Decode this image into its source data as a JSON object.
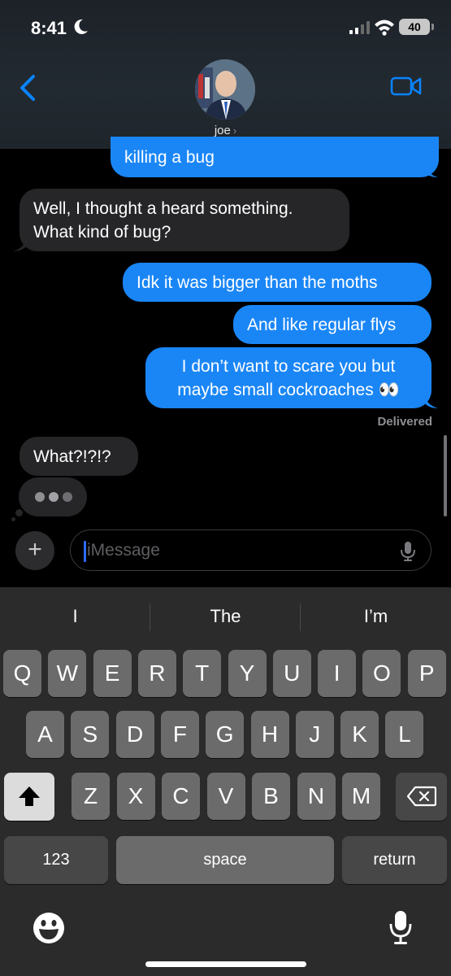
{
  "status_bar": {
    "time": "8:41",
    "battery": "40"
  },
  "header": {
    "contact_name": "joe",
    "chevron": "›"
  },
  "messages": [
    {
      "type": "sent",
      "text": "killing a bug"
    },
    {
      "type": "received",
      "text": "Well, I thought a heard something. What kind of bug?"
    },
    {
      "type": "sent",
      "text": "Idk it was bigger than the moths"
    },
    {
      "type": "sent",
      "text": "And like regular flys"
    },
    {
      "type": "sent",
      "text": "I don’t want to scare you but maybe small cockroaches 👀"
    },
    {
      "type": "received",
      "text": "What?!?!?"
    }
  ],
  "delivered_label": "Delivered",
  "input": {
    "placeholder": "iMessage",
    "plus": "+"
  },
  "keyboard": {
    "suggestions": [
      "I",
      "The",
      "I’m"
    ],
    "row1": [
      "Q",
      "W",
      "E",
      "R",
      "T",
      "Y",
      "U",
      "I",
      "O",
      "P"
    ],
    "row2": [
      "A",
      "S",
      "D",
      "F",
      "G",
      "H",
      "J",
      "K",
      "L"
    ],
    "row3": [
      "Z",
      "X",
      "C",
      "V",
      "B",
      "N",
      "M"
    ],
    "numbers_label": "123",
    "space_label": "space",
    "return_label": "return"
  },
  "colors": {
    "sent_bubble": "#1a86f6",
    "received_bubble": "#262628",
    "accent": "#0a84ff"
  },
  "icons": [
    "moon-icon",
    "signal-icon",
    "wifi-icon",
    "back-chevron-icon",
    "video-call-icon",
    "microphone-icon",
    "shift-icon",
    "delete-icon",
    "emoji-icon",
    "dictation-mic-icon"
  ]
}
